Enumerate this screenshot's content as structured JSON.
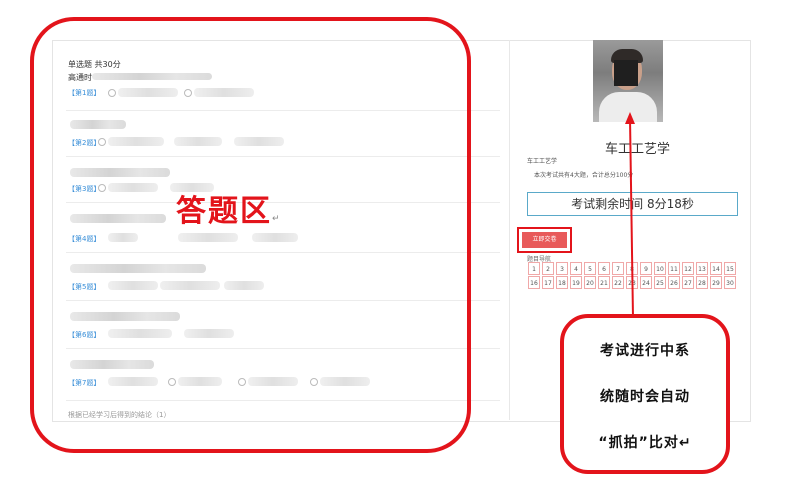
{
  "exam": {
    "section_title": "单选题 共30分",
    "first_question_stem": "高通时",
    "questions": [
      {
        "label": "【第1题】"
      },
      {
        "label": "【第2题】"
      },
      {
        "label": "【第3题】"
      },
      {
        "label": "【第4题】"
      },
      {
        "label": "【第5题】"
      },
      {
        "label": "【第6题】"
      },
      {
        "label": "【第7题】"
      }
    ],
    "bottom_text": "根据已经学习后得到的结论（1）"
  },
  "annotations": {
    "answer_area": "答题区",
    "return_mark": "↵",
    "callout_lines": [
      "考试进行中系",
      "统随时会自动",
      "“抓拍”比对↵"
    ]
  },
  "sidebar": {
    "student_name": "车工工艺学",
    "course_name": "车工工艺学",
    "exam_info": "本次考试共有4大题，合计总分100分",
    "timer_text": "考试剩余时间 8分18秒",
    "submit_label": "立即交卷",
    "nav_label": "题目导航",
    "question_numbers": [
      "1",
      "2",
      "3",
      "4",
      "5",
      "6",
      "7",
      "8",
      "9",
      "10",
      "11",
      "12",
      "13",
      "14",
      "15",
      "16",
      "17",
      "18",
      "19",
      "20",
      "21",
      "22",
      "23",
      "24",
      "25",
      "26",
      "27",
      "28",
      "29",
      "30"
    ]
  },
  "colors": {
    "annotation_red": "#e3141b",
    "question_link_blue": "#3a8fd8",
    "timer_border": "#5aa9c9",
    "submit_bg": "#e85a5a"
  }
}
